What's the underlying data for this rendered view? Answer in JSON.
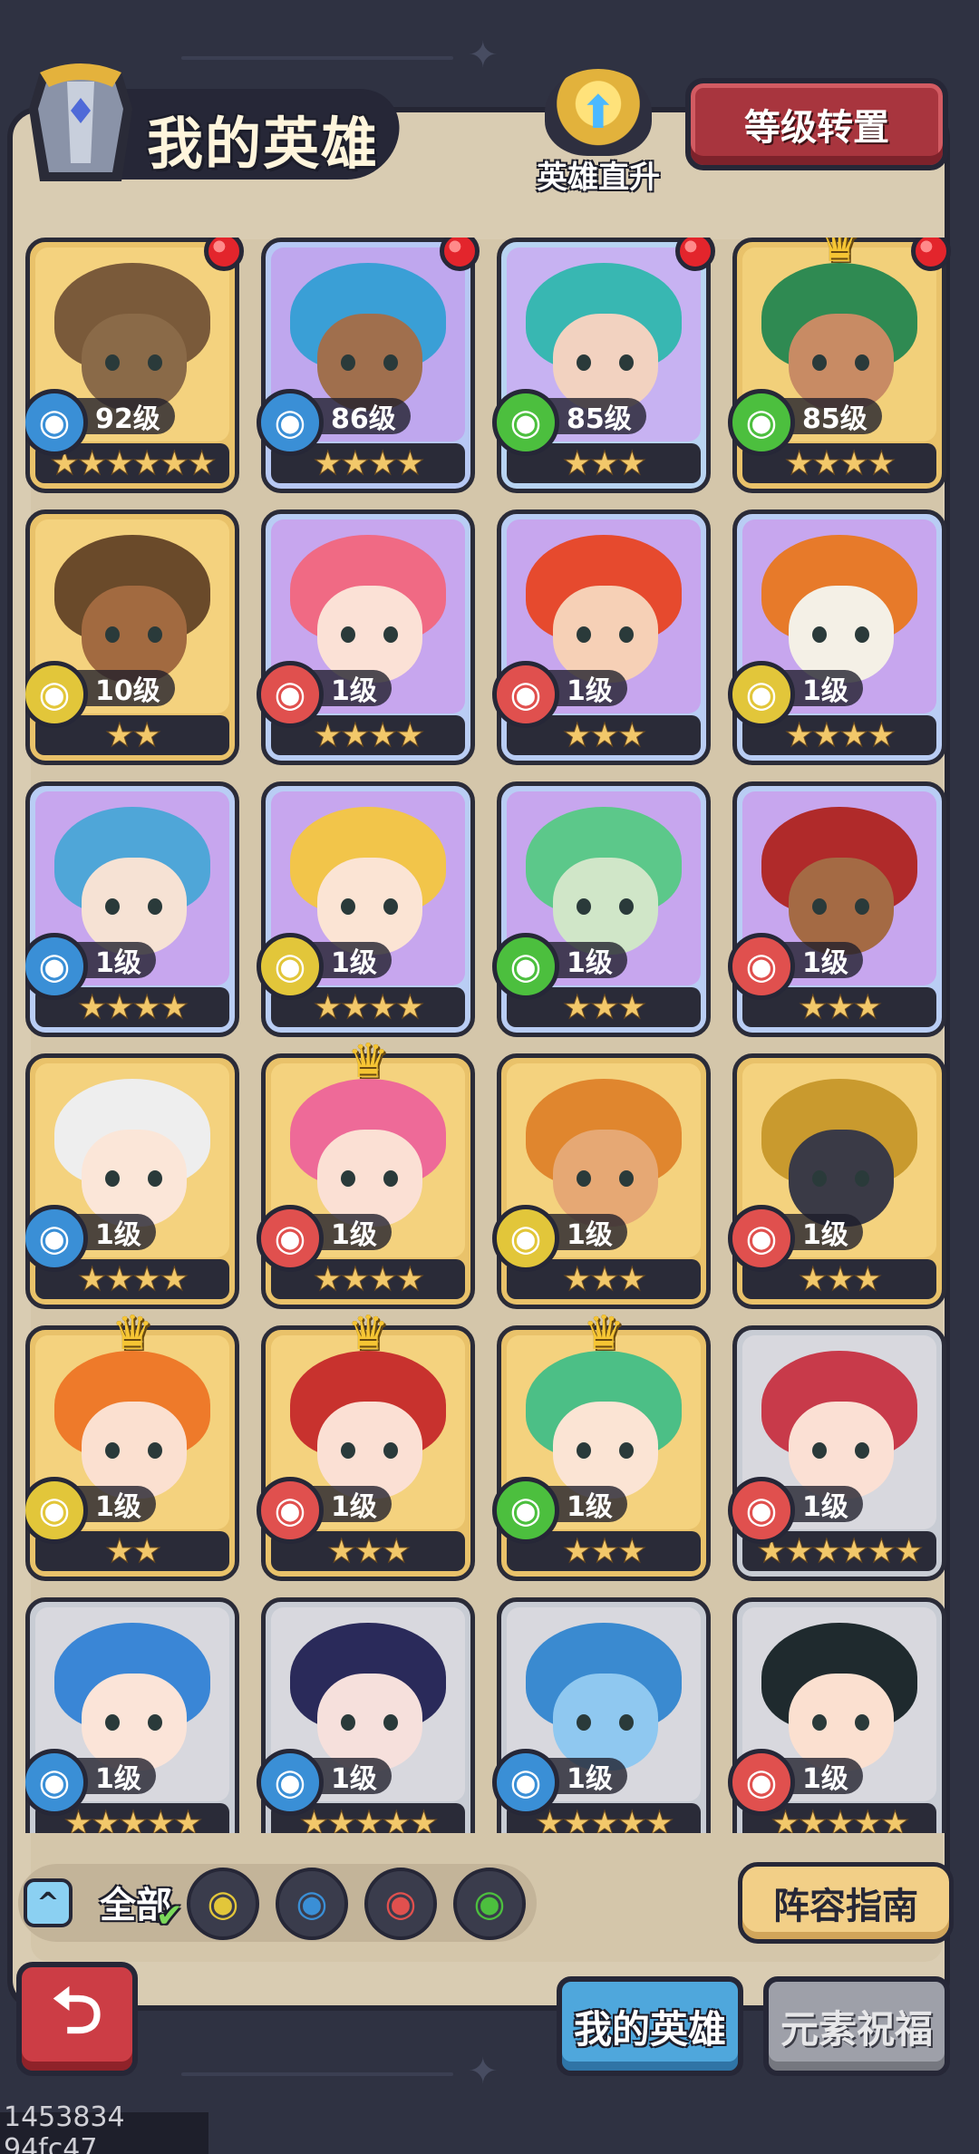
{
  "header": {
    "title": "我的英雄",
    "direct_upgrade": "英雄直升",
    "level_transfer": "等级转置"
  },
  "heroes": [
    {
      "level": "92级",
      "stars": "★★★★★★",
      "element": "water",
      "bg": "#f4d27e",
      "frame": "#e9c26a",
      "hair": "#7a5a3a",
      "skin": "#8a6a48",
      "dot": true,
      "crown": false
    },
    {
      "level": "86级",
      "stars": "★★★★",
      "element": "water",
      "bg": "#bfa7ee",
      "frame": "#b7c8f4",
      "hair": "#3a9fd6",
      "skin": "#a06f4d",
      "dot": true,
      "crown": false
    },
    {
      "level": "85级",
      "stars": "★★★",
      "element": "wind",
      "bg": "#c7b2f2",
      "frame": "#b8d4f2",
      "hair": "#38b7b2",
      "skin": "#f2d2c0",
      "dot": true,
      "crown": false
    },
    {
      "level": "85级",
      "stars": "★★★★",
      "element": "wind",
      "bg": "#f2d07a",
      "frame": "#e9c26a",
      "hair": "#2f8a52",
      "skin": "#c88b64",
      "dot": true,
      "crown": true
    },
    {
      "level": "10级",
      "stars": "★★",
      "element": "earth",
      "bg": "#f4d27e",
      "frame": "#e9c26a",
      "hair": "#6a4a2a",
      "skin": "#a26a40",
      "dot": false,
      "crown": false
    },
    {
      "level": "1级",
      "stars": "★★★★",
      "element": "fire",
      "bg": "#c7a6ee",
      "frame": "#b9cdf4",
      "hair": "#f06a84",
      "skin": "#fbe1d6",
      "dot": false,
      "crown": false
    },
    {
      "level": "1级",
      "stars": "★★★",
      "element": "fire",
      "bg": "#c7a6ee",
      "frame": "#b9cdf4",
      "hair": "#e64a2e",
      "skin": "#f6d0b6",
      "dot": false,
      "crown": false
    },
    {
      "level": "1级",
      "stars": "★★★★",
      "element": "earth",
      "bg": "#c7a6ee",
      "frame": "#b9cdf4",
      "hair": "#e77a2a",
      "skin": "#f4f0e6",
      "dot": false,
      "crown": false
    },
    {
      "level": "1级",
      "stars": "★★★★",
      "element": "water",
      "bg": "#c7a6ee",
      "frame": "#b9cdf4",
      "hair": "#4fa6d8",
      "skin": "#f6e2d4",
      "dot": false,
      "crown": false
    },
    {
      "level": "1级",
      "stars": "★★★★",
      "element": "earth",
      "bg": "#c7a6ee",
      "frame": "#b9cdf4",
      "hair": "#f2c54a",
      "skin": "#fbe4d4",
      "dot": false,
      "crown": false
    },
    {
      "level": "1级",
      "stars": "★★★",
      "element": "wind",
      "bg": "#c7a6ee",
      "frame": "#b9cdf4",
      "hair": "#5cc88a",
      "skin": "#d0e6c8",
      "dot": false,
      "crown": false
    },
    {
      "level": "1级",
      "stars": "★★★",
      "element": "fire",
      "bg": "#c7a6ee",
      "frame": "#b9cdf4",
      "hair": "#b02a2a",
      "skin": "#a46a44",
      "dot": false,
      "crown": false
    },
    {
      "level": "1级",
      "stars": "★★★★",
      "element": "water",
      "bg": "#f4d27e",
      "frame": "#e9c26a",
      "hair": "#eeeeee",
      "skin": "#fbe6d8",
      "dot": false,
      "crown": false
    },
    {
      "level": "1级",
      "stars": "★★★★",
      "element": "fire",
      "bg": "#f4d27e",
      "frame": "#e9c26a",
      "hair": "#ee6a98",
      "skin": "#fbe0d4",
      "dot": false,
      "crown": true
    },
    {
      "level": "1级",
      "stars": "★★★",
      "element": "earth",
      "bg": "#f4d27e",
      "frame": "#e9c26a",
      "hair": "#e0862e",
      "skin": "#e6a874",
      "dot": false,
      "crown": false
    },
    {
      "level": "1级",
      "stars": "★★★",
      "element": "fire",
      "bg": "#f4d27e",
      "frame": "#e9c26a",
      "hair": "#c99a2e",
      "skin": "#3a3a46",
      "dot": false,
      "crown": false
    },
    {
      "level": "1级",
      "stars": "★★",
      "element": "earth",
      "bg": "#f4d27e",
      "frame": "#e9c26a",
      "hair": "#ee7a2a",
      "skin": "#fbe0d0",
      "dot": false,
      "crown": true
    },
    {
      "level": "1级",
      "stars": "★★★",
      "element": "fire",
      "bg": "#f4d27e",
      "frame": "#e9c26a",
      "hair": "#c8322e",
      "skin": "#fbe0d4",
      "dot": false,
      "crown": true
    },
    {
      "level": "1级",
      "stars": "★★★",
      "element": "wind",
      "bg": "#f4d27e",
      "frame": "#e9c26a",
      "hair": "#4cbf86",
      "skin": "#fbe4d4",
      "dot": false,
      "crown": true
    },
    {
      "level": "1级",
      "stars": "★★★★★★",
      "element": "fire",
      "bg": "#d8d8de",
      "frame": "#c8ccd4",
      "hair": "#c83a4a",
      "skin": "#fbe0d4",
      "dot": false,
      "crown": false
    },
    {
      "level": "1级",
      "stars": "★★★★★",
      "element": "water",
      "bg": "#d8d8de",
      "frame": "#c8ccd4",
      "hair": "#3a86d6",
      "skin": "#fbe4d8",
      "dot": false,
      "crown": false
    },
    {
      "level": "1级",
      "stars": "★★★★★",
      "element": "water",
      "bg": "#d8d8de",
      "frame": "#c8ccd4",
      "hair": "#2a2a5a",
      "skin": "#f6e0dc",
      "dot": false,
      "crown": false
    },
    {
      "level": "1级",
      "stars": "★★★★★",
      "element": "water",
      "bg": "#d8d8de",
      "frame": "#c8ccd4",
      "hair": "#3a8ad0",
      "skin": "#8fc8f0",
      "dot": false,
      "crown": false
    },
    {
      "level": "1级",
      "stars": "★★★★★",
      "element": "fire",
      "bg": "#d8d8de",
      "frame": "#c8ccd4",
      "hair": "#1f2a2e",
      "skin": "#fbe0d0",
      "dot": false,
      "crown": false
    }
  ],
  "element_icons": {
    "water": {
      "icon": "water-drop-icon",
      "glyph": "◉",
      "color": "#3a8fd6"
    },
    "fire": {
      "icon": "fire-icon",
      "glyph": "◉",
      "color": "#e0504e"
    },
    "wind": {
      "icon": "wind-icon",
      "glyph": "◉",
      "color": "#4cbf3e"
    },
    "earth": {
      "icon": "earth-icon",
      "glyph": "◉",
      "color": "#e2c63a"
    }
  },
  "filter": {
    "collapse_glyph": "^",
    "all_label": "全部",
    "elements": [
      "earth",
      "water",
      "fire",
      "wind"
    ]
  },
  "guide_button": "阵容指南",
  "tabs": {
    "my_heroes": "我的英雄",
    "element_blessing": "元素祝福"
  },
  "back_glyph": "⮌",
  "watermark": "1453834 94fc47"
}
